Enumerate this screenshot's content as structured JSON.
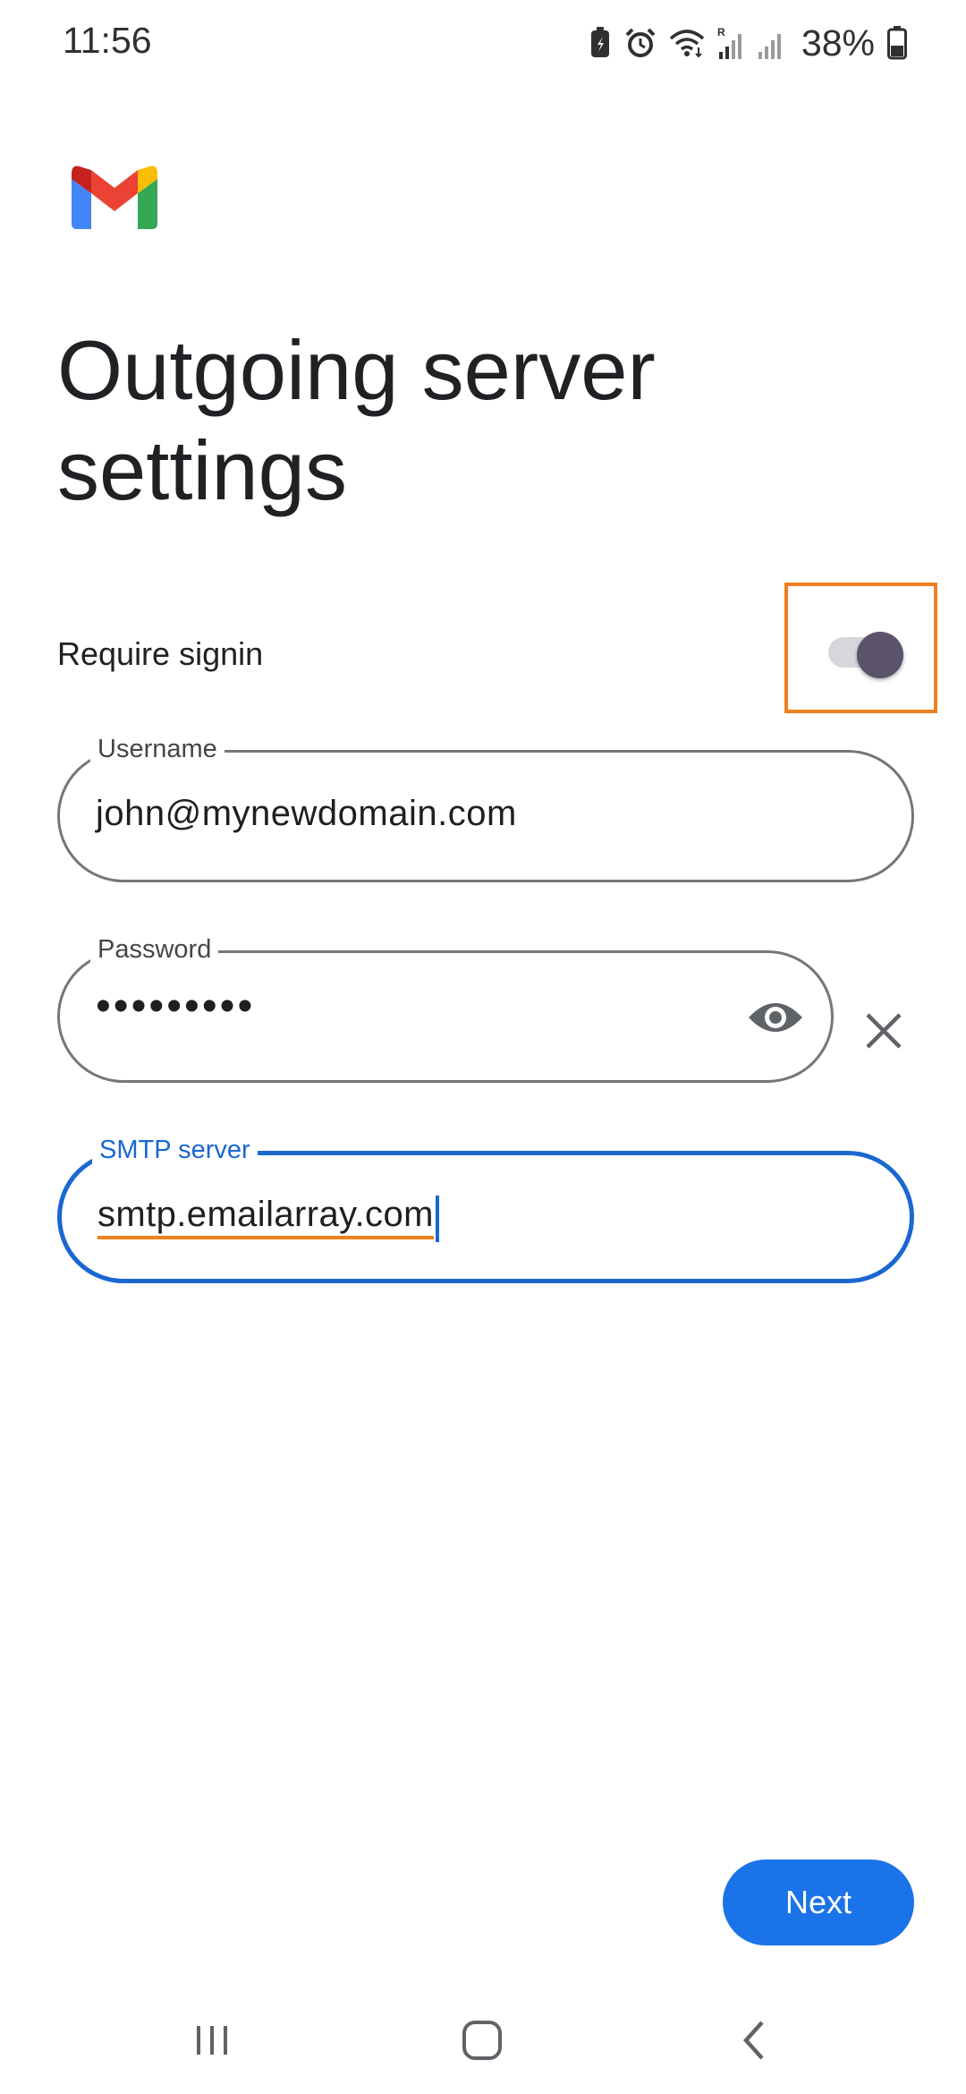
{
  "status_bar": {
    "time": "11:56",
    "battery_percent": "38%",
    "icons": [
      "battery-saver-icon",
      "alarm-icon",
      "wifi-icon",
      "signal-roaming-icon",
      "signal-icon",
      "battery-icon"
    ]
  },
  "app": {
    "logo": "gmail-logo-icon"
  },
  "page": {
    "title": "Outgoing server settings"
  },
  "require_signin": {
    "label": "Require signin",
    "enabled": true
  },
  "fields": {
    "username": {
      "label": "Username",
      "value": "john@mynewdomain.com"
    },
    "password": {
      "label": "Password",
      "value": "•••••••••"
    },
    "smtp": {
      "label": "SMTP server",
      "value": "smtp.emailarray.com"
    }
  },
  "actions": {
    "next_label": "Next"
  },
  "colors": {
    "accent": "#1a73e8",
    "focus_border": "#1a67d2",
    "highlight": "#f07f1f",
    "toggle_thumb": "#5b536b"
  }
}
